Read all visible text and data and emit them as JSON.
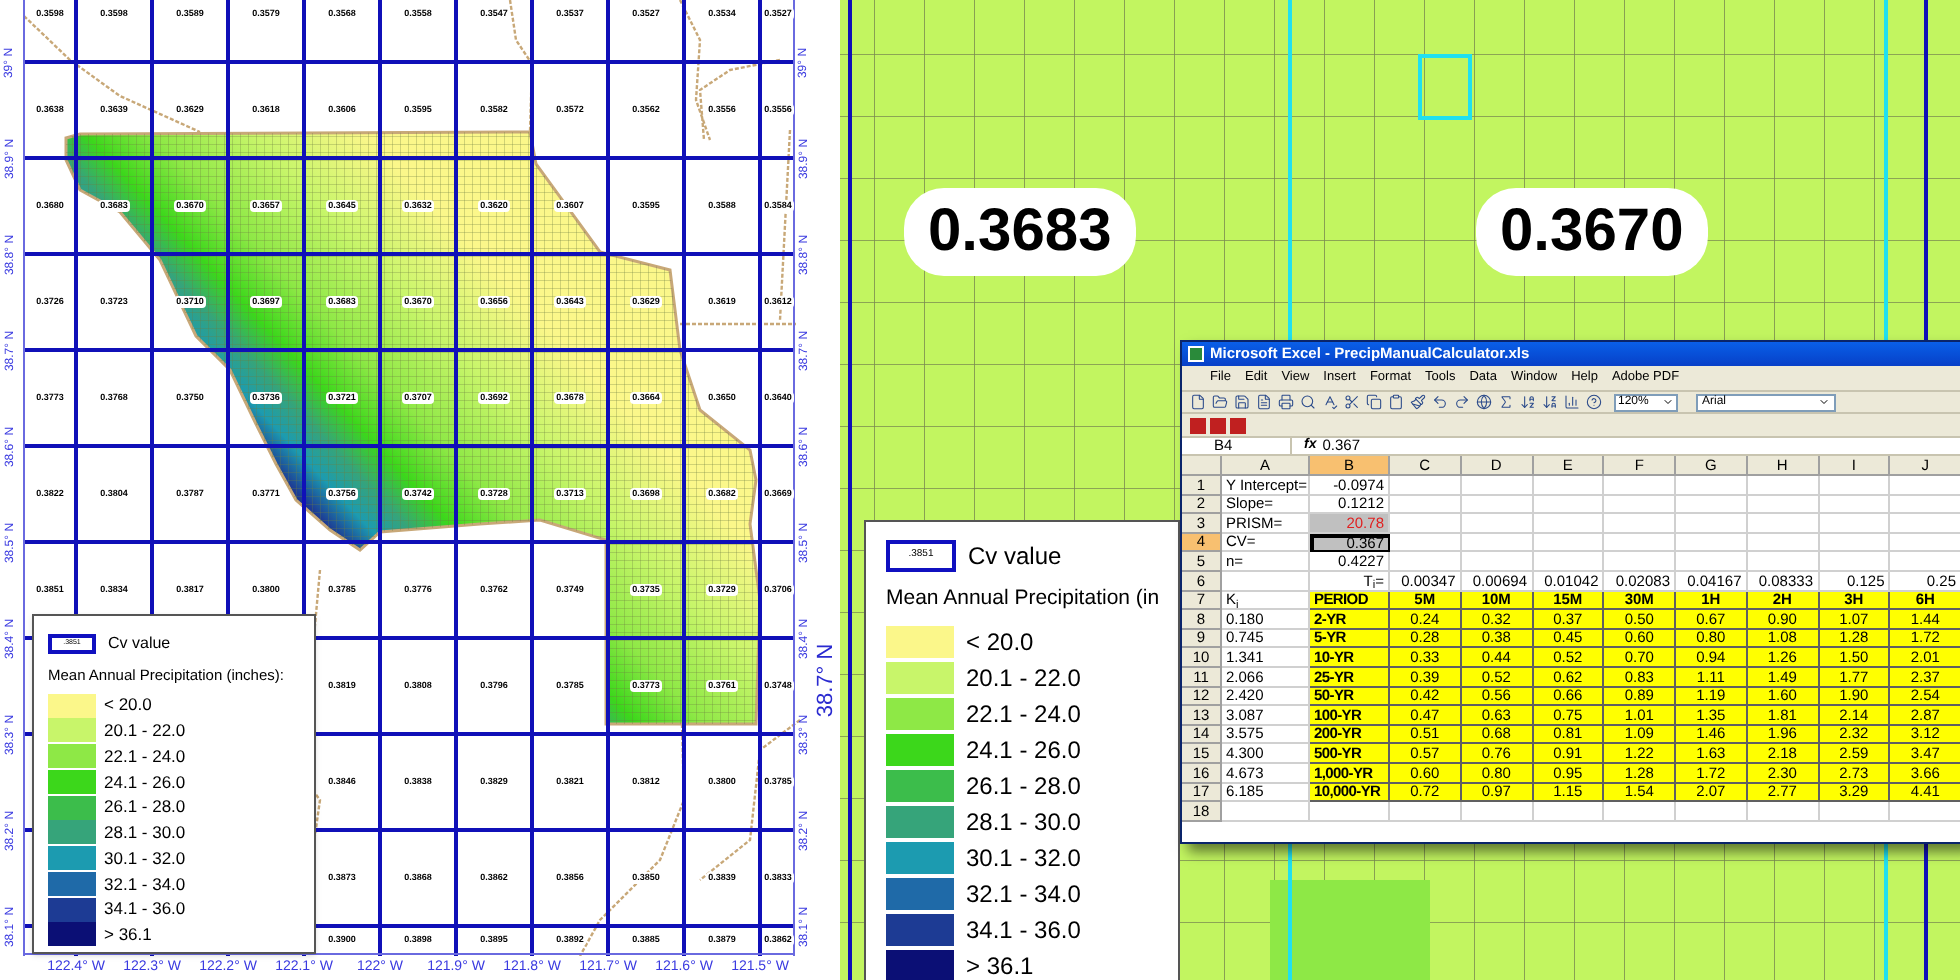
{
  "left_map": {
    "cells": [
      [
        "0.3598",
        "0.3598",
        "0.3589",
        "0.3579",
        "0.3568",
        "0.3558",
        "0.3547",
        "0.3537",
        "0.3527",
        "0.3534",
        "0.3527"
      ],
      [
        "0.3638",
        "0.3639",
        "0.3629",
        "0.3618",
        "0.3606",
        "0.3595",
        "0.3582",
        "0.3572",
        "0.3562",
        "0.3556",
        "0.3556"
      ],
      [
        "0.3680",
        "0.3683",
        "0.3670",
        "0.3657",
        "0.3645",
        "0.3632",
        "0.3620",
        "0.3607",
        "0.3595",
        "0.3588",
        "0.3584"
      ],
      [
        "0.3726",
        "0.3723",
        "0.3710",
        "0.3697",
        "0.3683",
        "0.3670",
        "0.3656",
        "0.3643",
        "0.3629",
        "0.3619",
        "0.3612"
      ],
      [
        "0.3773",
        "0.3768",
        "0.3750",
        "0.3736",
        "0.3721",
        "0.3707",
        "0.3692",
        "0.3678",
        "0.3664",
        "0.3650",
        "0.3640"
      ],
      [
        "0.3822",
        "0.3804",
        "0.3787",
        "0.3771",
        "0.3756",
        "0.3742",
        "0.3728",
        "0.3713",
        "0.3698",
        "0.3682",
        "0.3669"
      ],
      [
        "0.3851",
        "0.3834",
        "0.3817",
        "0.3800",
        "0.3785",
        "0.3776",
        "0.3762",
        "0.3749",
        "0.3735",
        "0.3729",
        "0.3706"
      ],
      [
        "0.3819",
        "0.3808",
        "0.3796",
        "0.3785",
        "0.3773",
        "0.3761",
        "0.3748"
      ],
      [
        "0.3846",
        "0.3838",
        "0.3829",
        "0.3821",
        "0.3812",
        "0.3800",
        "0.3785"
      ],
      [
        "0.3873",
        "0.3868",
        "0.3862",
        "0.3856",
        "0.3850",
        "0.3839",
        "0.3833"
      ],
      [
        "0.3900",
        "0.3898",
        "0.3895",
        "0.3892",
        "0.3885",
        "0.3879",
        "0.3862"
      ]
    ],
    "lat_labels_left": [
      "39° N",
      "38.9° N",
      "38.8° N",
      "38.7° N",
      "38.6° N",
      "38.5° N",
      "38.4° N",
      "38.3° N",
      "38.2° N",
      "38.1° N"
    ],
    "lat_labels_right": [
      "39° N",
      "38.9° N",
      "38.8° N",
      "38.7° N",
      "38.6° N",
      "38.5° N",
      "38.4° N",
      "38.3° N",
      "38.2° N",
      "38.1° N"
    ],
    "side_label": "38.7° N",
    "lon_labels": [
      "122.4° W",
      "122.3° W",
      "122.2° W",
      "122.1° W",
      "122° W",
      "121.9° W",
      "121.8° W",
      "121.7° W",
      "121.6° W",
      "121.5° W"
    ],
    "legend": {
      "sample": ".3851",
      "sample_label": "Cv value",
      "title": "Mean Annual Precipitation (inches):",
      "classes": [
        {
          "label": "< 20.0",
          "color": "#fbf78a"
        },
        {
          "label": "20.1 - 22.0",
          "color": "#c8f56a"
        },
        {
          "label": "22.1 - 24.0",
          "color": "#8ee846"
        },
        {
          "label": "24.1 - 26.0",
          "color": "#3cd71b"
        },
        {
          "label": "26.1 - 28.0",
          "color": "#3cbd4b"
        },
        {
          "label": "28.1 - 30.0",
          "color": "#36a47a"
        },
        {
          "label": "30.1 - 32.0",
          "color": "#1c9bb0"
        },
        {
          "label": "32.1 - 34.0",
          "color": "#1f6aa8"
        },
        {
          "label": "34.1 - 36.0",
          "color": "#1d3b94"
        },
        {
          "label": "> 36.1",
          "color": "#0b0f75"
        }
      ]
    }
  },
  "zoom_map": {
    "labels": [
      "0.3683",
      "0.3670"
    ],
    "legend": {
      "sample": ".3851",
      "sample_label": "Cv value",
      "title": "Mean Annual Precipitation (in",
      "classes": [
        {
          "label": "< 20.0",
          "color": "#fbf78a"
        },
        {
          "label": "20.1 - 22.0",
          "color": "#c8f56a"
        },
        {
          "label": "22.1 - 24.0",
          "color": "#8ee846"
        },
        {
          "label": "24.1 - 26.0",
          "color": "#3cd71b"
        },
        {
          "label": "26.1 - 28.0",
          "color": "#3cbd4b"
        },
        {
          "label": "28.1 - 30.0",
          "color": "#36a47a"
        },
        {
          "label": "30.1 - 32.0",
          "color": "#1c9bb0"
        },
        {
          "label": "32.1 - 34.0",
          "color": "#1f6aa8"
        },
        {
          "label": "34.1 - 36.0",
          "color": "#1d3b94"
        },
        {
          "label": "> 36.1",
          "color": "#0b0f75"
        }
      ]
    }
  },
  "spreadsheet": {
    "title": "Microsoft Excel - PrecipManualCalculator.xls",
    "menu": [
      "File",
      "Edit",
      "View",
      "Insert",
      "Format",
      "Tools",
      "Data",
      "Window",
      "Help",
      "Adobe PDF"
    ],
    "zoom": "120%",
    "font": "Arial",
    "name_box": "B4",
    "formula_label": "fx",
    "formula": "0.367",
    "columns": [
      {
        "label": "A",
        "selected": false
      },
      {
        "label": "B",
        "selected": true
      },
      {
        "label": "C",
        "selected": false
      },
      {
        "label": "D",
        "selected": false
      },
      {
        "label": "E",
        "selected": false
      },
      {
        "label": "F",
        "selected": false
      },
      {
        "label": "G",
        "selected": false
      },
      {
        "label": "H",
        "selected": false
      },
      {
        "label": "I",
        "selected": false
      },
      {
        "label": "J",
        "selected": false
      }
    ],
    "rows": [
      {
        "number": "1",
        "selected": false,
        "kind": "param",
        "cells": [
          "Y Intercept=",
          "-0.0974"
        ]
      },
      {
        "number": "2",
        "selected": false,
        "kind": "param",
        "cells": [
          "Slope=",
          "0.1212"
        ]
      },
      {
        "number": "3",
        "selected": false,
        "kind": "flagged",
        "cells": [
          "PRISM=",
          "20.78"
        ]
      },
      {
        "number": "4",
        "selected": true,
        "kind": "param",
        "cells": [
          "CV=",
          "0.367"
        ]
      },
      {
        "number": "5",
        "selected": false,
        "kind": "param",
        "cells": [
          "n=",
          "0.4227"
        ]
      },
      {
        "number": "6",
        "selected": false,
        "kind": "ti",
        "cells": [
          "",
          "T$_{i}$=",
          "0.00347",
          "0.00694",
          "0.01042",
          "0.02083",
          "0.04167",
          "0.08333",
          "0.125",
          "0.25"
        ]
      },
      {
        "number": "7",
        "selected": false,
        "kind": "header",
        "cells": [
          "K$_{i}$",
          "PERIOD",
          "5M",
          "10M",
          "15M",
          "30M",
          "1H",
          "2H",
          "3H",
          "6H"
        ]
      },
      {
        "number": "8",
        "selected": false,
        "kind": "data",
        "cells": [
          "0.180",
          "2-YR",
          "0.24",
          "0.32",
          "0.37",
          "0.50",
          "0.67",
          "0.90",
          "1.07",
          "1.44"
        ]
      },
      {
        "number": "9",
        "selected": false,
        "kind": "data",
        "cells": [
          "0.745",
          "5-YR",
          "0.28",
          "0.38",
          "0.45",
          "0.60",
          "0.80",
          "1.08",
          "1.28",
          "1.72"
        ]
      },
      {
        "number": "10",
        "selected": false,
        "kind": "data",
        "cells": [
          "1.341",
          "10-YR",
          "0.33",
          "0.44",
          "0.52",
          "0.70",
          "0.94",
          "1.26",
          "1.50",
          "2.01"
        ]
      },
      {
        "number": "11",
        "selected": false,
        "kind": "data",
        "cells": [
          "2.066",
          "25-YR",
          "0.39",
          "0.52",
          "0.62",
          "0.83",
          "1.11",
          "1.49",
          "1.77",
          "2.37"
        ]
      },
      {
        "number": "12",
        "selected": false,
        "kind": "data",
        "cells": [
          "2.420",
          "50-YR",
          "0.42",
          "0.56",
          "0.66",
          "0.89",
          "1.19",
          "1.60",
          "1.90",
          "2.54"
        ]
      },
      {
        "number": "13",
        "selected": false,
        "kind": "data",
        "cells": [
          "3.087",
          "100-YR",
          "0.47",
          "0.63",
          "0.75",
          "1.01",
          "1.35",
          "1.81",
          "2.14",
          "2.87"
        ]
      },
      {
        "number": "14",
        "selected": false,
        "kind": "data",
        "cells": [
          "3.575",
          "200-YR",
          "0.51",
          "0.68",
          "0.81",
          "1.09",
          "1.46",
          "1.96",
          "2.32",
          "3.12"
        ]
      },
      {
        "number": "15",
        "selected": false,
        "kind": "data",
        "cells": [
          "4.300",
          "500-YR",
          "0.57",
          "0.76",
          "0.91",
          "1.22",
          "1.63",
          "2.18",
          "2.59",
          "3.47"
        ]
      },
      {
        "number": "16",
        "selected": false,
        "kind": "data",
        "cells": [
          "4.673",
          "1,000-YR",
          "0.60",
          "0.80",
          "0.95",
          "1.28",
          "1.72",
          "2.30",
          "2.73",
          "3.66"
        ]
      },
      {
        "number": "17",
        "selected": false,
        "kind": "data",
        "cells": [
          "6.185",
          "10,000-YR",
          "0.72",
          "0.97",
          "1.15",
          "1.54",
          "2.07",
          "2.77",
          "3.29",
          "4.41"
        ]
      },
      {
        "number": "18",
        "selected": false,
        "kind": "empty",
        "cells": []
      }
    ]
  }
}
